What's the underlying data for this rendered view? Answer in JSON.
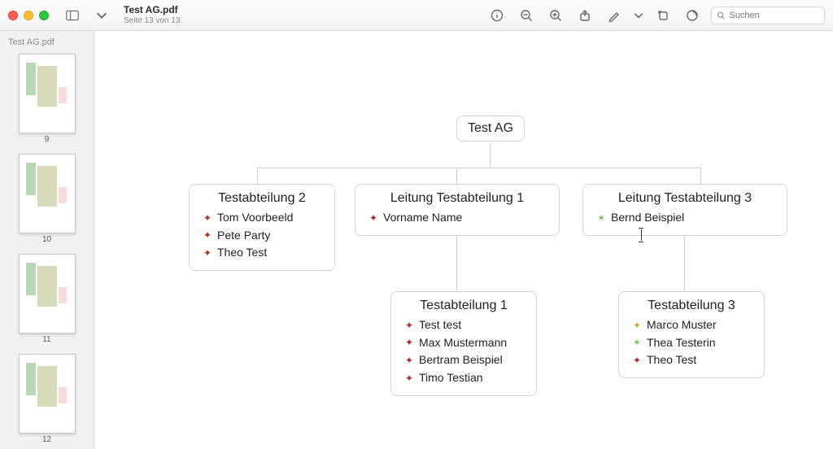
{
  "window": {
    "title": "Test AG.pdf",
    "subtitle": "Seite 13 von 13"
  },
  "search": {
    "placeholder": "Suchen",
    "value": ""
  },
  "sidebar": {
    "filename": "Test AG.pdf",
    "pages": [
      {
        "number": "9"
      },
      {
        "number": "10"
      },
      {
        "number": "11"
      },
      {
        "number": "12"
      }
    ]
  },
  "chart_data": {
    "type": "org-chart",
    "root": {
      "title": "Test AG",
      "children": [
        {
          "title": "Testabteilung 2",
          "members": [
            {
              "name": "Tom Voorbeeld",
              "marker": "red"
            },
            {
              "name": "Pete Party",
              "marker": "red"
            },
            {
              "name": "Theo Test",
              "marker": "red"
            }
          ],
          "children": []
        },
        {
          "title": "Leitung Testabteilung 1",
          "members": [
            {
              "name": "Vorname Name",
              "marker": "red"
            }
          ],
          "children": [
            {
              "title": "Testabteilung 1",
              "members": [
                {
                  "name": "Test test",
                  "marker": "red"
                },
                {
                  "name": "Max Mustermann",
                  "marker": "red"
                },
                {
                  "name": "Bertram Beispiel",
                  "marker": "red"
                },
                {
                  "name": "Timo Testian",
                  "marker": "red"
                }
              ]
            }
          ]
        },
        {
          "title": "Leitung Testabteilung 3",
          "members": [
            {
              "name": "Bernd Beispiel",
              "marker": "green"
            }
          ],
          "children": [
            {
              "title": "Testabteilung 3",
              "members": [
                {
                  "name": "Marco Muster",
                  "marker": "yellow"
                },
                {
                  "name": "Thea Testerin",
                  "marker": "green"
                },
                {
                  "name": "Theo Test",
                  "marker": "red"
                }
              ]
            }
          ]
        }
      ]
    }
  }
}
